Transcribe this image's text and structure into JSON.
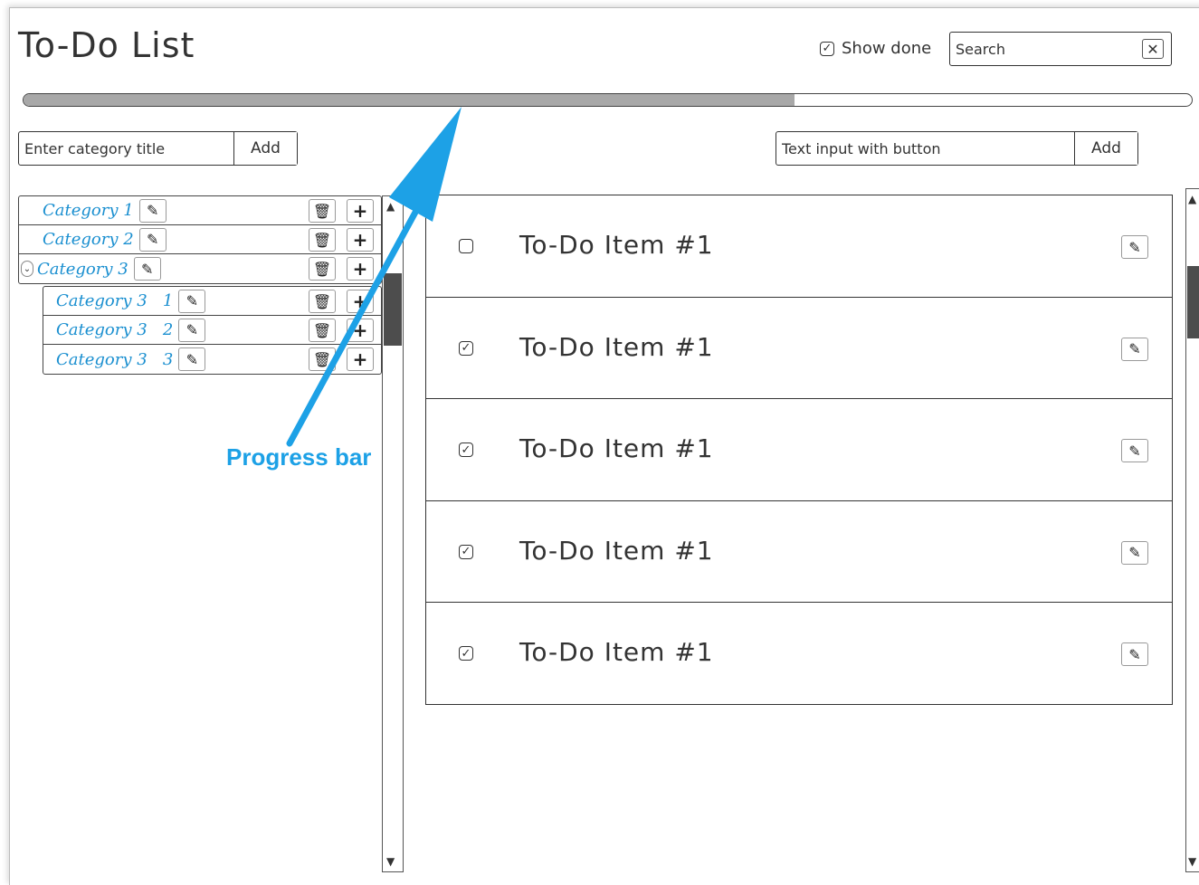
{
  "header": {
    "title": "To-Do List",
    "show_done_label": "Show done",
    "show_done_checked": true,
    "search_placeholder": "Search",
    "search_clear_icon": "close-icon"
  },
  "progress": {
    "value_fraction": 0.66
  },
  "category_input": {
    "placeholder": "Enter category title",
    "button_label": "Add"
  },
  "item_input": {
    "placeholder": "Text input with button",
    "button_label": "Add"
  },
  "categories": [
    {
      "label": "Category 1"
    },
    {
      "label": "Category 2"
    },
    {
      "label": "Category 3",
      "expanded": true
    }
  ],
  "subcategories": [
    {
      "label": "Category 3   1"
    },
    {
      "label": "Category 3   2"
    },
    {
      "label": "Category 3   3"
    }
  ],
  "todos": [
    {
      "text": "To-Do Item #1",
      "done": false
    },
    {
      "text": "To-Do Item #1",
      "done": true
    },
    {
      "text": "To-Do Item #1",
      "done": true
    },
    {
      "text": "To-Do Item #1",
      "done": true
    },
    {
      "text": "To-Do Item #1",
      "done": true
    }
  ],
  "annotation": {
    "label": "Progress bar",
    "color": "#1da1e6"
  },
  "icons": {
    "edit": "edit-icon",
    "trash": "trash-icon",
    "plus": "plus-icon",
    "expand": "chevron-down-icon"
  }
}
